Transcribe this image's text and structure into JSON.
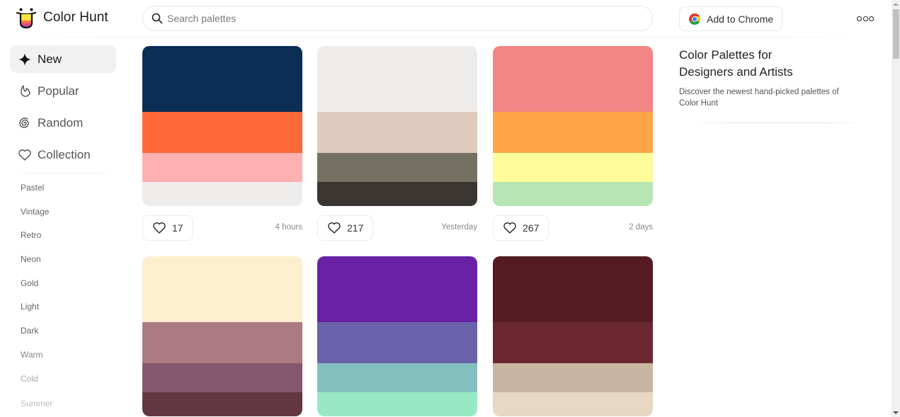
{
  "app": {
    "name": "Color Hunt",
    "logo_icon": "smiley-tongue-logo-icon"
  },
  "header": {
    "search": {
      "placeholder": "Search palettes",
      "value": "",
      "icon": "search-icon"
    },
    "chrome_button": {
      "label": "Add to Chrome",
      "icon": "chrome-icon"
    },
    "more_button": {
      "icon": "more-dots-icon"
    }
  },
  "sidebar": {
    "nav": [
      {
        "label": "New",
        "icon": "sparkle-icon",
        "active": true
      },
      {
        "label": "Popular",
        "icon": "flame-icon",
        "active": false
      },
      {
        "label": "Random",
        "icon": "spiral-icon",
        "active": false
      },
      {
        "label": "Collection",
        "icon": "heart-icon",
        "active": false
      }
    ],
    "tags": [
      "Pastel",
      "Vintage",
      "Retro",
      "Neon",
      "Gold",
      "Light",
      "Dark",
      "Warm",
      "Cold",
      "Summer"
    ]
  },
  "feed": {
    "palettes": [
      {
        "colors": [
          "#0b2d56",
          "#fd6838",
          "#ffb0b0",
          "#eeecea"
        ],
        "likes": "17",
        "time": "4 hours"
      },
      {
        "colors": [
          "#eeecea",
          "#decbbd",
          "#747163",
          "#3b3532"
        ],
        "likes": "217",
        "time": "Yesterday"
      },
      {
        "colors": [
          "#f28585",
          "#ffa447",
          "#fffc9b",
          "#b7e5b4"
        ],
        "likes": "267",
        "time": "2 days"
      },
      {
        "colors": [
          "#fdefce",
          "#ab7a83",
          "#85576e",
          "#633741"
        ],
        "likes": "",
        "time": ""
      },
      {
        "colors": [
          "#6a21a6",
          "#6a63ac",
          "#84bfbf",
          "#97e9c6"
        ],
        "likes": "",
        "time": ""
      },
      {
        "colors": [
          "#541c22",
          "#6b2730",
          "#c8b5a0",
          "#e8d8c3"
        ],
        "likes": "",
        "time": ""
      }
    ]
  },
  "right_panel": {
    "title": "Color Palettes for Designers and Artists",
    "description": "Discover the newest hand-picked palettes of Color Hunt"
  }
}
